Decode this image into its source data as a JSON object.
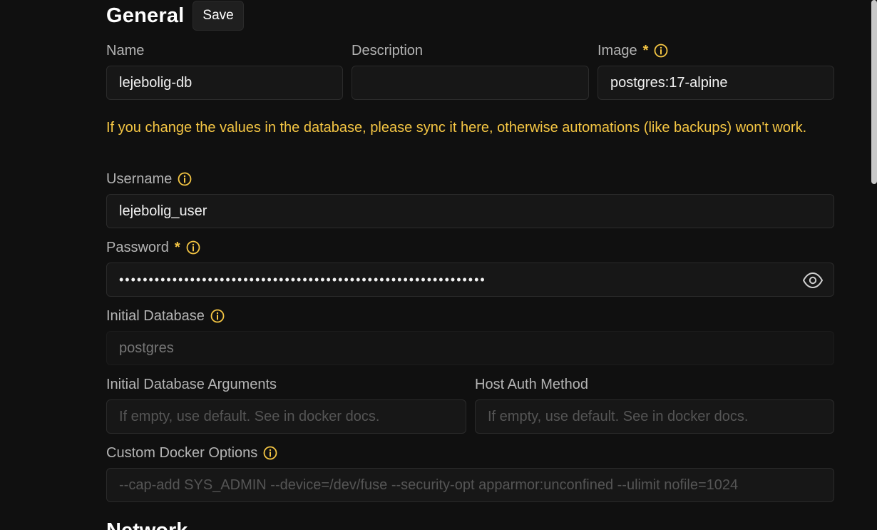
{
  "section": {
    "title": "General",
    "save_label": "Save",
    "next_title": "Network"
  },
  "fields": {
    "name": {
      "label": "Name",
      "value": "lejebolig-db"
    },
    "description": {
      "label": "Description",
      "value": ""
    },
    "image": {
      "label": "Image",
      "required_mark": "*",
      "value": "postgres:17-alpine"
    },
    "warning": "If you change the values in the database, please sync it here, otherwise automations (like backups) won't work.",
    "username": {
      "label": "Username",
      "value": "lejebolig_user"
    },
    "password": {
      "label": "Password",
      "required_mark": "*",
      "value": "••••••••••••••••••••••••••••••••••••••••••••••••••••••••••••••"
    },
    "initial_database": {
      "label": "Initial Database",
      "value": "postgres"
    },
    "initial_db_args": {
      "label": "Initial Database Arguments",
      "placeholder": "If empty, use default. See in docker docs."
    },
    "host_auth": {
      "label": "Host Auth Method",
      "placeholder": "If empty, use default. See in docker docs."
    },
    "custom_docker": {
      "label": "Custom Docker Options",
      "placeholder": "--cap-add SYS_ADMIN --device=/dev/fuse --security-opt apparmor:unconfined --ulimit nofile=1024"
    }
  },
  "icons": {
    "info": "info-circle-icon",
    "eye": "eye-icon"
  },
  "colors": {
    "background": "#101010",
    "accent": "#f6c744",
    "field_bg": "#171717"
  }
}
